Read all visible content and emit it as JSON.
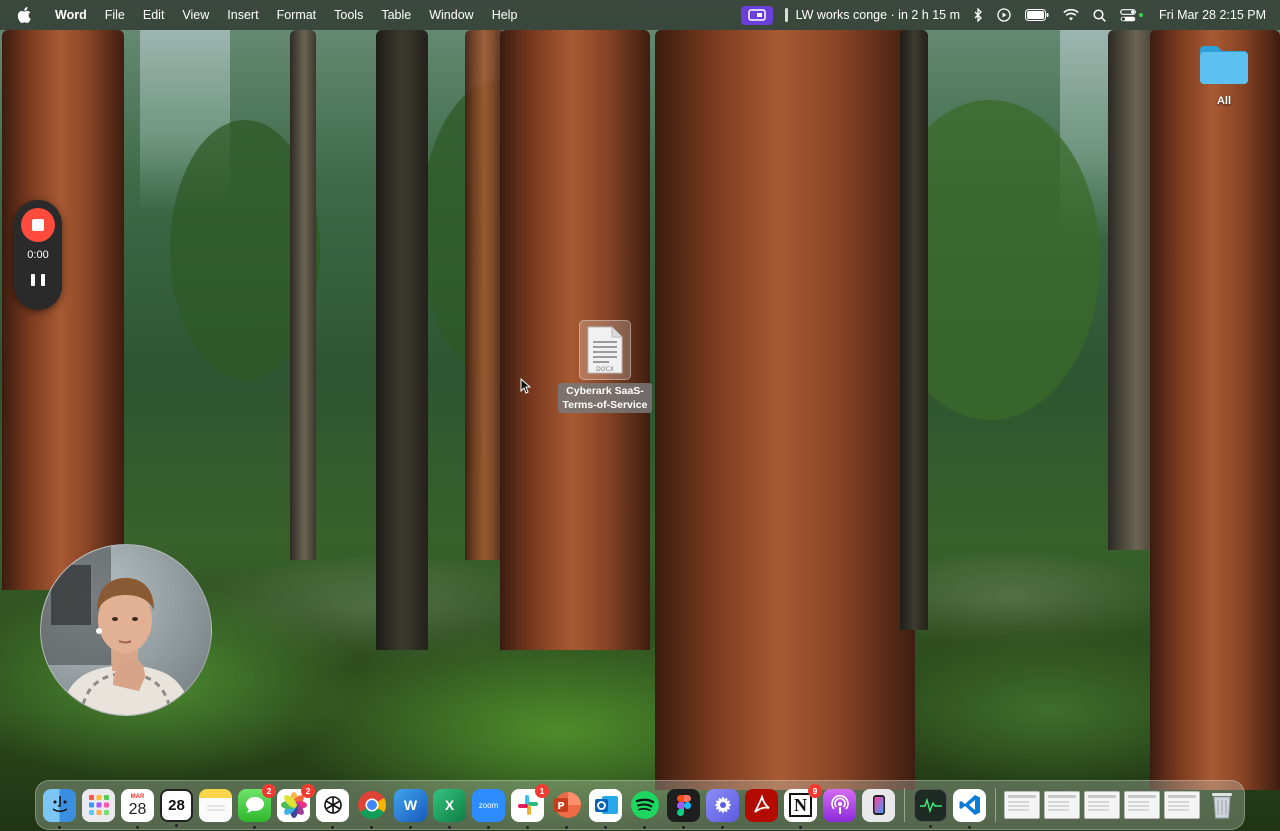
{
  "menubar": {
    "app_name": "Word",
    "menus": [
      "File",
      "Edit",
      "View",
      "Insert",
      "Format",
      "Tools",
      "Table",
      "Window",
      "Help"
    ],
    "meeting_text": "LW works conge · in 2 h 15 m",
    "clock": "Fri Mar 28  2:15 PM"
  },
  "desktop": {
    "folder_label": "All",
    "file_label_line1": "Cyberark SaaS-",
    "file_label_line2": "Terms-of-Service",
    "file_type": "DOCX"
  },
  "recorder": {
    "time": "0:00"
  },
  "dock": {
    "calendar_month": "MAR",
    "calendar_day": "28",
    "calendar2_day": "28",
    "messages_badge": "2",
    "photos_badge": "2",
    "slack_badge": "1",
    "notion_badge": "9",
    "zoom_label": "zoom",
    "notion_label": "N"
  },
  "colors": {
    "accent_purple": "#6b3fd9",
    "record_red": "#ff4b3e",
    "folder_blue": "#3db0e8"
  }
}
